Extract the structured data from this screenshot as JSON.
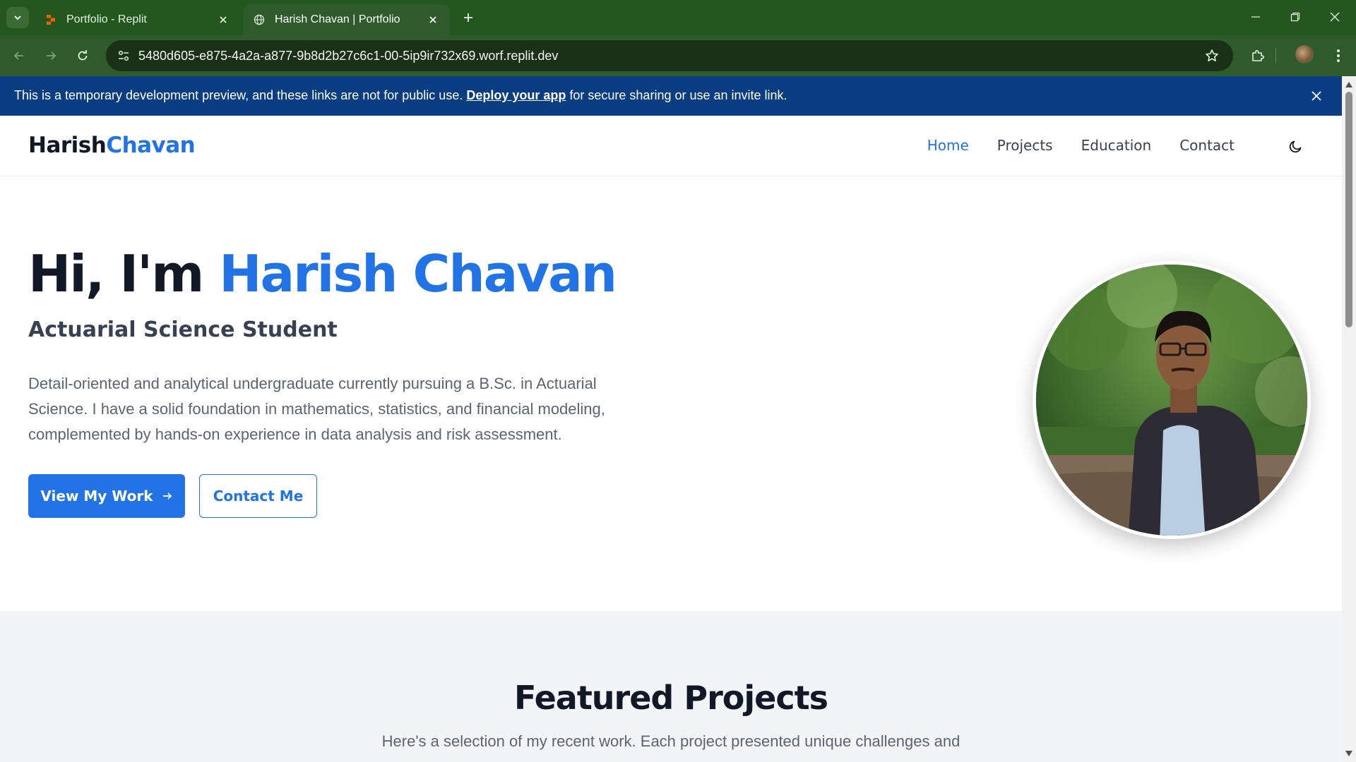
{
  "browser": {
    "tabs": [
      {
        "title": "Portfolio - Replit",
        "active": false,
        "favicon": "replit-icon"
      },
      {
        "title": "Harish Chavan | Portfolio",
        "active": true,
        "favicon": "globe-icon"
      }
    ],
    "url": "5480d605-e875-4a2a-a877-9b8d2b27c6c1-00-5ip9ir732x69.worf.replit.dev",
    "colors": {
      "frame": "#23571f",
      "toolbar": "#2f5b2c",
      "omnibox": "#1a3017"
    }
  },
  "banner": {
    "text_before": "This is a temporary development preview, and these links are not for public use.",
    "link": "Deploy your app",
    "text_after": "for secure sharing or use an invite link.",
    "color": "#0a3d82"
  },
  "site": {
    "logo_first": "Harish",
    "logo_last": "Chavan",
    "accent_color": "#2173e6",
    "nav": [
      {
        "label": "Home",
        "active": true
      },
      {
        "label": "Projects",
        "active": false
      },
      {
        "label": "Education",
        "active": false
      },
      {
        "label": "Contact",
        "active": false
      }
    ],
    "theme_toggle_icon": "moon-icon",
    "hero": {
      "title_prefix": "Hi, I'm",
      "title_name": "Harish Chavan",
      "subtitle": "Actuarial Science Student",
      "description": "Detail-oriented and analytical undergraduate currently pursuing a B.Sc. in Actuarial Science. I have a solid foundation in mathematics, statistics, and financial modeling, complemented by hands-on experience in data analysis and risk assessment.",
      "primary_button": "View My Work",
      "primary_button_icon": "arrow-right-icon",
      "secondary_button": "Contact Me"
    },
    "projects": {
      "title": "Featured Projects",
      "subtitle": "Here's a selection of my recent work. Each project presented unique challenges and"
    }
  }
}
